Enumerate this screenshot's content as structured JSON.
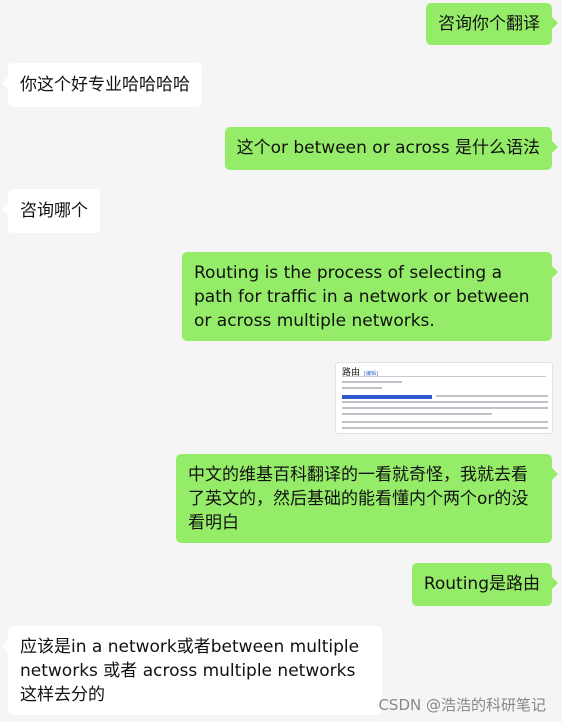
{
  "messages": [
    {
      "side": "me",
      "text": "咨询你个翻译"
    },
    {
      "side": "other",
      "text": "你这个好专业哈哈哈哈"
    },
    {
      "side": "me",
      "text": "这个or between or across 是什么语法"
    },
    {
      "side": "other",
      "text": "咨询哪个"
    },
    {
      "side": "me",
      "text": "Routing is the process of selecting a path for traffic in a network or between or across multiple networks."
    },
    {
      "side": "me",
      "type": "image",
      "title": "路由",
      "title_tag": "[编辑]"
    },
    {
      "side": "me",
      "text": "中文的维基百科翻译的一看就奇怪，我就去看了英文的，然后基础的能看懂内个两个or的没看明白"
    },
    {
      "side": "me",
      "text": "Routing是路由"
    },
    {
      "side": "other",
      "text": "应该是in a network或者between multiple networks 或者 across multiple networks 这样去分的"
    }
  ],
  "watermark": "CSDN @浩浩的科研笔记",
  "colors": {
    "background": "#f5f5f5",
    "me_bubble": "#95ec69",
    "other_bubble": "#ffffff"
  }
}
